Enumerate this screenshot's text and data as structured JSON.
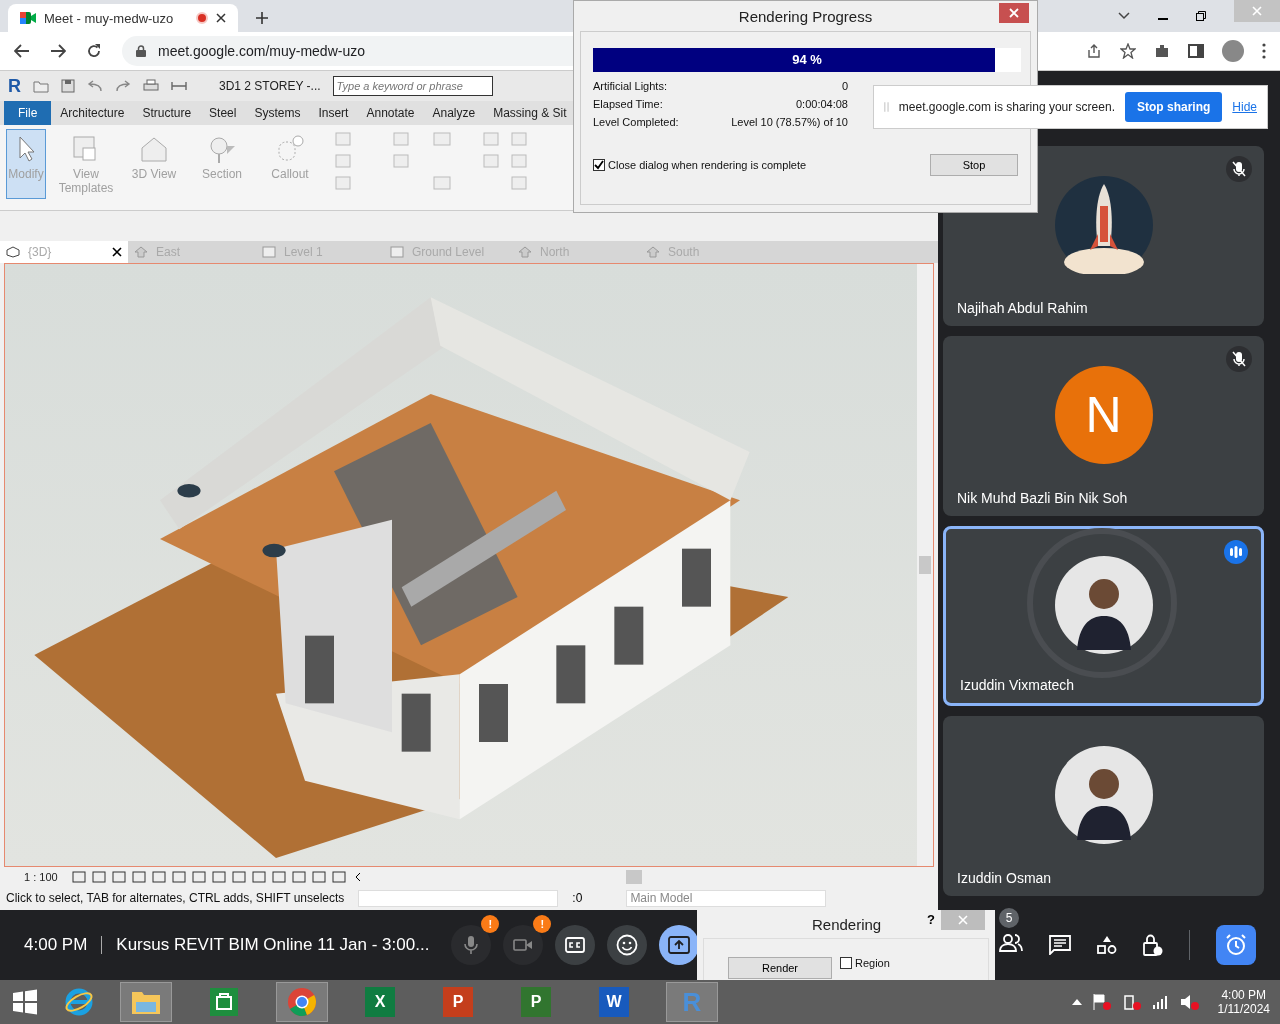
{
  "browser": {
    "tab_title": "Meet - muy-medw-uzo",
    "url": "meet.google.com/muy-medw-uzo",
    "recording": true
  },
  "sharing_bar": {
    "message": "meet.google.com is sharing your screen.",
    "stop": "Stop sharing",
    "hide": "Hide"
  },
  "revit": {
    "logo": "R",
    "project_title": "3D1 2 STOREY -...",
    "search_placeholder": "Type a keyword or phrase",
    "ribbon_tabs": [
      {
        "label": "File",
        "selected": true
      },
      {
        "label": "Architecture",
        "selected": false
      },
      {
        "label": "Structure",
        "selected": false
      },
      {
        "label": "Steel",
        "selected": false
      },
      {
        "label": "Systems",
        "selected": false
      },
      {
        "label": "Insert",
        "selected": false
      },
      {
        "label": "Annotate",
        "selected": false
      },
      {
        "label": "Analyze",
        "selected": false
      },
      {
        "label": "Massing & Sit",
        "selected": false
      }
    ],
    "tools": [
      {
        "label": "Modify",
        "kind": "modify",
        "selected": true
      },
      {
        "label": "View Templates",
        "kind": "templates",
        "selected": false
      },
      {
        "label": "3D View",
        "kind": "house",
        "selected": false
      },
      {
        "label": "Section",
        "kind": "section",
        "selected": false
      },
      {
        "label": "Callout",
        "kind": "callout",
        "selected": false
      }
    ],
    "view_tabs": [
      {
        "label": "{3D}",
        "kind": "cube",
        "selected": true
      },
      {
        "label": "East",
        "kind": "elevation",
        "selected": false
      },
      {
        "label": "Level 1",
        "kind": "plan",
        "selected": false
      },
      {
        "label": "Ground Level",
        "kind": "plan",
        "selected": false
      },
      {
        "label": "North",
        "kind": "elevation",
        "selected": false
      },
      {
        "label": "South",
        "kind": "elevation",
        "selected": false
      }
    ],
    "scale": "1 : 100",
    "status": "Click to select, TAB for alternates, CTRL adds, SHIFT unselects",
    "worksets": ":0",
    "model": "Main Model"
  },
  "render_dialog": {
    "title": "Rendering Progress",
    "percent": "94 %",
    "level": 0.94,
    "rows": [
      {
        "label": "Artificial Lights:",
        "value": "0"
      },
      {
        "label": "Elapsed Time:",
        "value": "0:00:04:08"
      },
      {
        "label": "Level Completed:",
        "value": "Level 10 (78.57%) of 10"
      }
    ],
    "close_option": {
      "label": "Close dialog when rendering is complete",
      "checked": true
    },
    "stop": "Stop"
  },
  "participants": [
    {
      "name": "Najihah Abdul Rahim",
      "kind": "rocket",
      "muted": true,
      "speaking": false
    },
    {
      "name": "Nik Muhd Bazli Bin Nik Soh",
      "kind": "letter",
      "letter": "N",
      "color": "#e8710a",
      "muted": true,
      "speaking": false
    },
    {
      "name": "Izuddin Vixmatech",
      "kind": "photo",
      "muted": false,
      "speaking": true
    },
    {
      "name": "Izuddin Osman",
      "kind": "photo",
      "muted": false,
      "speaking": false
    }
  ],
  "meet_bar": {
    "time": "4:00 PM",
    "meeting": "Kursus REVIT BIM Online 11 Jan - 3:00...",
    "mic_alert": "!",
    "camera_alert": "!",
    "people_count": "5"
  },
  "render_panel": {
    "title": "Rendering",
    "help": "?",
    "render": "Render",
    "region": {
      "label": "Region",
      "checked": false
    }
  },
  "taskbar": {
    "apps": [
      {
        "kind": "explorer",
        "selected": true
      },
      {
        "kind": "store",
        "selected": false
      },
      {
        "kind": "chrome",
        "selected": true
      },
      {
        "kind": "office",
        "letter": "X",
        "color": "#107c41",
        "selected": false
      },
      {
        "kind": "office",
        "letter": "P",
        "color": "#c43e1c",
        "selected": false
      },
      {
        "kind": "office",
        "letter": "P",
        "color": "#31752f",
        "selected": false
      },
      {
        "kind": "office",
        "letter": "W",
        "color": "#185abd",
        "selected": false
      },
      {
        "kind": "revit",
        "letter": "R",
        "selected": true
      }
    ],
    "time": "4:00 PM",
    "date": "1/11/2024"
  }
}
